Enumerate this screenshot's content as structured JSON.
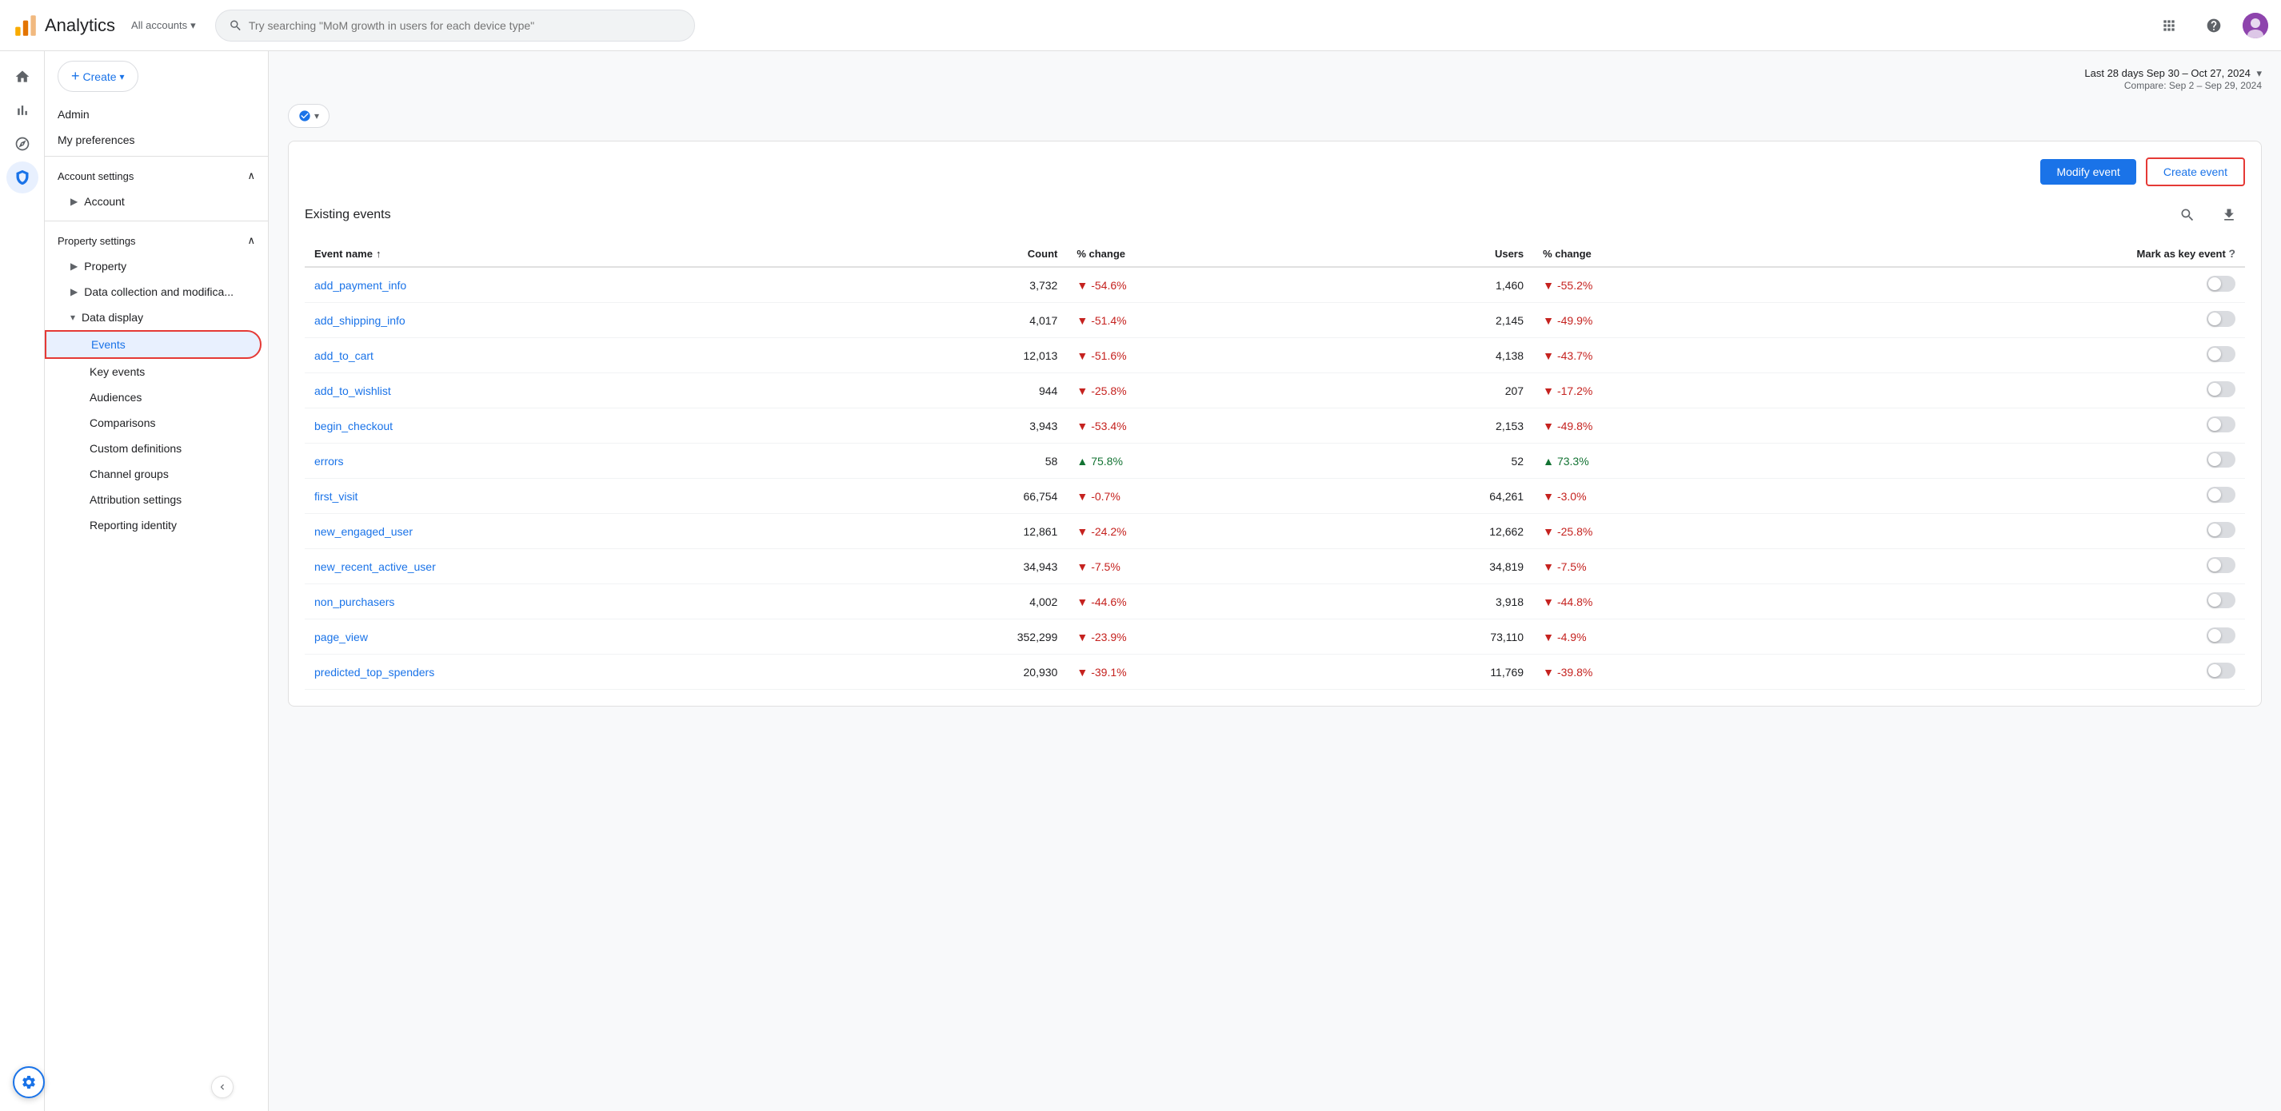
{
  "app": {
    "title": "Analytics",
    "logo_alt": "Google Analytics logo"
  },
  "topbar": {
    "account_label": "All accounts",
    "search_placeholder": "Try searching \"MoM growth in users for each device type\"",
    "icons": [
      "grid-icon",
      "help-icon",
      "account-icon"
    ]
  },
  "left_nav": {
    "create_label": "Create",
    "admin_label": "Admin",
    "my_preferences_label": "My preferences",
    "account_settings": {
      "label": "Account settings",
      "expanded": true,
      "items": [
        {
          "label": "Account",
          "indent": 1
        }
      ]
    },
    "property_settings": {
      "label": "Property settings",
      "expanded": true,
      "items": [
        {
          "label": "Property",
          "indent": 1
        },
        {
          "label": "Data collection and modifica...",
          "indent": 1
        },
        {
          "label": "Data display",
          "indent": 1,
          "expanded": true,
          "sub_items": [
            {
              "label": "Events",
              "active": true
            },
            {
              "label": "Key events"
            },
            {
              "label": "Audiences"
            },
            {
              "label": "Comparisons"
            },
            {
              "label": "Custom definitions"
            },
            {
              "label": "Channel groups"
            },
            {
              "label": "Attribution settings"
            },
            {
              "label": "Reporting identity"
            }
          ]
        }
      ]
    }
  },
  "date_range": {
    "label": "Last 28 days",
    "range": "Sep 30 – Oct 27, 2024",
    "compare_label": "Compare: Sep 2 – Sep 29, 2024"
  },
  "events_card": {
    "title": "Existing events",
    "modify_event_label": "Modify event",
    "create_event_label": "Create event",
    "table": {
      "columns": [
        {
          "label": "Event name",
          "sort": true
        },
        {
          "label": "Count",
          "align": "right"
        },
        {
          "label": "% change",
          "align": "left"
        },
        {
          "label": "Users",
          "align": "right"
        },
        {
          "label": "% change",
          "align": "left"
        },
        {
          "label": "Mark as key event",
          "help": true,
          "align": "right"
        }
      ],
      "rows": [
        {
          "name": "add_payment_info",
          "count": "3,732",
          "count_change": "-54.6%",
          "count_dir": "down",
          "users": "1,460",
          "users_change": "-55.2%",
          "users_dir": "down"
        },
        {
          "name": "add_shipping_info",
          "count": "4,017",
          "count_change": "-51.4%",
          "count_dir": "down",
          "users": "2,145",
          "users_change": "-49.9%",
          "users_dir": "down"
        },
        {
          "name": "add_to_cart",
          "count": "12,013",
          "count_change": "-51.6%",
          "count_dir": "down",
          "users": "4,138",
          "users_change": "-43.7%",
          "users_dir": "down"
        },
        {
          "name": "add_to_wishlist",
          "count": "944",
          "count_change": "-25.8%",
          "count_dir": "down",
          "users": "207",
          "users_change": "-17.2%",
          "users_dir": "down"
        },
        {
          "name": "begin_checkout",
          "count": "3,943",
          "count_change": "-53.4%",
          "count_dir": "down",
          "users": "2,153",
          "users_change": "-49.8%",
          "users_dir": "down"
        },
        {
          "name": "errors",
          "count": "58",
          "count_change": "75.8%",
          "count_dir": "up",
          "users": "52",
          "users_change": "73.3%",
          "users_dir": "up"
        },
        {
          "name": "first_visit",
          "count": "66,754",
          "count_change": "-0.7%",
          "count_dir": "down",
          "users": "64,261",
          "users_change": "-3.0%",
          "users_dir": "down"
        },
        {
          "name": "new_engaged_user",
          "count": "12,861",
          "count_change": "-24.2%",
          "count_dir": "down",
          "users": "12,662",
          "users_change": "-25.8%",
          "users_dir": "down"
        },
        {
          "name": "new_recent_active_user",
          "count": "34,943",
          "count_change": "-7.5%",
          "count_dir": "down",
          "users": "34,819",
          "users_change": "-7.5%",
          "users_dir": "down"
        },
        {
          "name": "non_purchasers",
          "count": "4,002",
          "count_change": "-44.6%",
          "count_dir": "down",
          "users": "3,918",
          "users_change": "-44.8%",
          "users_dir": "down"
        },
        {
          "name": "page_view",
          "count": "352,299",
          "count_change": "-23.9%",
          "count_dir": "down",
          "users": "73,110",
          "users_change": "-4.9%",
          "users_dir": "down"
        },
        {
          "name": "predicted_top_spenders",
          "count": "20,930",
          "count_change": "-39.1%",
          "count_dir": "down",
          "users": "11,769",
          "users_change": "-39.8%",
          "users_dir": "down"
        }
      ]
    }
  },
  "settings_icon": "gear-icon",
  "collapse_icon": "chevron-left-icon"
}
